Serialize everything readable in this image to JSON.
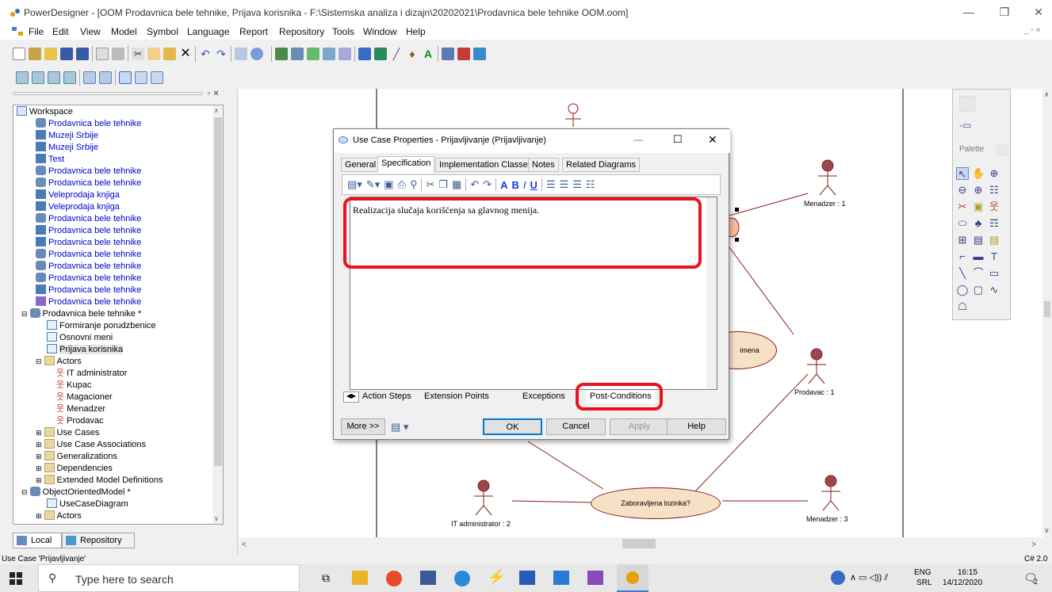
{
  "app": {
    "title": "PowerDesigner - [OOM Prodavnica bele tehnike, Prijava korisnika - F:\\Sistemska analiza i dizajn\\20202021\\Prodavnica bele tehnike OOM.oom]"
  },
  "menu": [
    "File",
    "Edit",
    "View",
    "Model",
    "Symbol",
    "Language",
    "Report",
    "Repository",
    "Tools",
    "Window",
    "Help"
  ],
  "tree": {
    "items": [
      {
        "label": "Workspace",
        "color": "black"
      },
      {
        "label": "Prodavnica bele tehnike",
        "color": "blue"
      },
      {
        "label": "Muzeji Srbije",
        "color": "blue"
      },
      {
        "label": "Muzeji Srbije",
        "color": "blue"
      },
      {
        "label": "Test",
        "color": "blue"
      },
      {
        "label": "Prodavnica bele tehnike",
        "color": "blue"
      },
      {
        "label": "Prodavnica bele tehnike",
        "color": "blue"
      },
      {
        "label": "Veleprodaja knjiga",
        "color": "blue"
      },
      {
        "label": "Veleprodaja knjiga",
        "color": "blue"
      },
      {
        "label": "Prodavnica bele tehnike",
        "color": "blue"
      },
      {
        "label": "Prodavnica bele tehnike",
        "color": "blue"
      },
      {
        "label": "Prodavnica bele tehnike",
        "color": "blue"
      },
      {
        "label": "Prodavnica bele tehnike",
        "color": "blue"
      },
      {
        "label": "Prodavnica bele tehnike",
        "color": "blue"
      },
      {
        "label": "Prodavnica bele tehnike",
        "color": "blue"
      },
      {
        "label": "Prodavnica bele tehnike",
        "color": "blue"
      },
      {
        "label": "Prodavnica bele tehnike",
        "color": "blue"
      },
      {
        "label": "Prodavnica bele tehnike *",
        "color": "black"
      },
      {
        "label": "Formiranje porudzbenice",
        "color": "black"
      },
      {
        "label": "Osnovni meni",
        "color": "black"
      },
      {
        "label": "Prijava korisnika",
        "color": "black"
      },
      {
        "label": "Actors",
        "color": "black"
      },
      {
        "label": "IT administrator",
        "color": "black"
      },
      {
        "label": "Kupac",
        "color": "black"
      },
      {
        "label": "Magacioner",
        "color": "black"
      },
      {
        "label": "Menadzer",
        "color": "black"
      },
      {
        "label": "Prodavac",
        "color": "black"
      },
      {
        "label": "Use Cases",
        "color": "black"
      },
      {
        "label": "Use Case Associations",
        "color": "black"
      },
      {
        "label": "Generalizations",
        "color": "black"
      },
      {
        "label": "Dependencies",
        "color": "black"
      },
      {
        "label": "Extended Model Definitions",
        "color": "black"
      },
      {
        "label": "ObjectOrientedModel *",
        "color": "black"
      },
      {
        "label": "UseCaseDiagram",
        "color": "black"
      },
      {
        "label": "Actors",
        "color": "black"
      }
    ],
    "tabs": [
      "Local",
      "Repository"
    ]
  },
  "palette": {
    "title": "Palette"
  },
  "diagram": {
    "actors": [
      "Menadzer : 1",
      "Prodavac : 1",
      "IT administrator : 2",
      "Menadzer : 3"
    ],
    "use_cases": [
      "imena",
      "Zaboravljena lozinka?"
    ]
  },
  "dialog": {
    "title": "Use Case Properties - Prijavljivanje (Prijavljivanje)",
    "tabs": [
      "General",
      "Specification",
      "Implementation Classes",
      "Notes",
      "Related Diagrams"
    ],
    "active_tab": "Specification",
    "editor_text": "Realizacija slučaja korišćenja sa glavnog menija.",
    "sub_tabs": [
      "Action Steps",
      "Extension Points",
      "Exceptions",
      "Post-Conditions"
    ],
    "active_sub_tab": "Post-Conditions",
    "buttons": {
      "more": "More >>",
      "ok": "OK",
      "cancel": "Cancel",
      "apply": "Apply",
      "help": "Help"
    }
  },
  "status": {
    "left": "Use Case 'Prijavljivanje'",
    "right": "C# 2.0"
  },
  "taskbar": {
    "search_placeholder": "Type here to search",
    "lang": "ENG",
    "layout": "SRL",
    "time": "16:15",
    "date": "14/12/2020",
    "notif_count": "2"
  },
  "colors": {
    "highlight": "#e8141e",
    "actor": "#8b1a1a",
    "use_case_fill": "#f7e0c5",
    "tree_blue": "#0000cc"
  }
}
